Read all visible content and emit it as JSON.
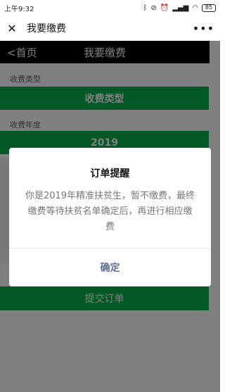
{
  "status_bar": {
    "time": "上午9:32",
    "icons": [
      "bluetooth-icon",
      "mute-icon",
      "alarm-icon",
      "signal-icon",
      "wifi-icon"
    ],
    "battery": "85"
  },
  "navbar": {
    "close_icon": "✕",
    "title": "我要缴费",
    "more_icon": "•••"
  },
  "app_header": {
    "back": "<首页",
    "title": "我要缴费"
  },
  "form": {
    "fee_type_label": "收费类型",
    "fee_type_button": "收费类型",
    "fee_year_label": "收费年度",
    "fee_year_value": "2019",
    "submit_button": "提交订单"
  },
  "modal": {
    "title": "订单提醒",
    "message": "你是2019年精准扶贫生，暂不缴费，最终缴费等待扶贫名单确定后，再进行相应缴费",
    "ok_button": "确定"
  },
  "colors": {
    "accent_green": "#08b04a",
    "ok_text": "#5a6e9a",
    "header_bg": "#000000"
  }
}
